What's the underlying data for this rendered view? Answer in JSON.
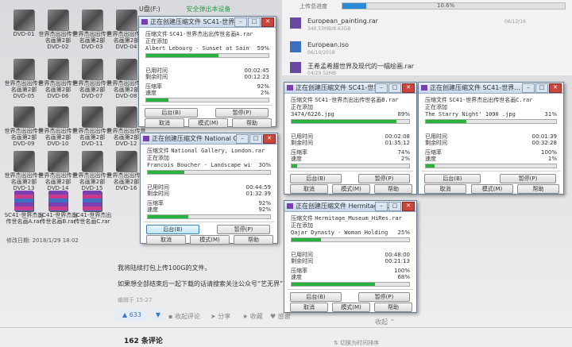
{
  "explorer": {
    "path_label": "U盘(F:)",
    "safe_eject": "安全弹出本设备",
    "icons": [
      {
        "label": "DVD-01",
        "type": "folder"
      },
      {
        "label": "世界杰出出传世名画第2部DVD-02",
        "type": "folder"
      },
      {
        "label": "世界杰出出传世名画第2部DVD-03",
        "type": "folder"
      },
      {
        "label": "世界杰出出传世名画第2部DVD-04",
        "type": "folder"
      },
      {
        "label": "世界杰出出传世名画第2部DVD-05",
        "type": "folder"
      },
      {
        "label": "世界杰出出传世名画第2部DVD-06",
        "type": "folder"
      },
      {
        "label": "世界杰出出传世名画第2部DVD-07",
        "type": "folder"
      },
      {
        "label": "世界杰出出传世名画第2部DVD-08",
        "type": "folder"
      },
      {
        "label": "世界杰出出传世名画第2部DVD-09",
        "type": "folder"
      },
      {
        "label": "世界杰出出传世名画第2部DVD-10",
        "type": "folder"
      },
      {
        "label": "世界杰出出传世名画第2部DVD-11",
        "type": "folder"
      },
      {
        "label": "世界杰出出传世名画第2部DVD-12",
        "type": "folder"
      },
      {
        "label": "世界杰出出传世名画第2部DVD-13",
        "type": "folder"
      },
      {
        "label": "世界杰出出传世名画第2部DVD-14",
        "type": "folder"
      },
      {
        "label": "世界杰出出传世名画第2部DVD-15",
        "type": "folder"
      },
      {
        "label": "世界杰出出传世名画第2部DVD-16",
        "type": "folder"
      },
      {
        "label": "SC41-世界杰出传世名画A.rar",
        "type": "rar"
      },
      {
        "label": "SC41-世界杰出传世名画B.rar",
        "type": "rar"
      },
      {
        "label": "SC41-世界杰出传世名画C.rar",
        "type": "rar"
      }
    ],
    "modified": "修改日期: 2018/1/29 18:02"
  },
  "upload": {
    "header": "上传总进度",
    "percent_text": "10.6%",
    "percent": 0.106,
    "files": [
      {
        "name": "European_painting.rar",
        "meta": "340.53MB/8.63GB",
        "date": "06/12/16"
      },
      {
        "name": "European.iso",
        "meta": "06/10/2018",
        "date": ""
      },
      {
        "name": "王希孟希腊世界及现代的一幅绘画.rar",
        "meta": "04/29 52MB",
        "date": ""
      }
    ]
  },
  "dialog_common": {
    "compress_label": "压缩文件",
    "adding": "正在添加",
    "elapsed": "已用时间",
    "remaining": "剩余时间",
    "ratio": "压缩率",
    "speed": "速度",
    "btn_background": "后台(B)",
    "btn_pause": "暂停(P)",
    "btn_cancel": "取消",
    "btn_mode": "模式(M)",
    "btn_help": "帮助"
  },
  "dialogs": [
    {
      "title": "正在创建压缩文件 SC41-世界...",
      "archive": "SC41-世界杰出出传世名画A.rar",
      "file": "Albert Lebourg - Sunset at Saint Mamm",
      "file_pct": "59%",
      "file_progress": 0.59,
      "elapsed": "00:02:45",
      "remaining": "00:12:23",
      "ratio": "92%",
      "speed": "2%",
      "total_progress": 0.18
    },
    {
      "title": "正在创建压缩文件 National Ga...",
      "archive": "National Gallery, London.rar",
      "file": "Francois Boucher - Landscape with a Wa",
      "file_pct": "30%",
      "file_progress": 0.3,
      "elapsed": "00:44:59",
      "remaining": "01:32:39",
      "ratio": "92%",
      "speed": "92%",
      "total_progress": 0.33
    },
    {
      "title": "正在创建压缩文件 SC41-世界...",
      "archive": "SC41-世界杰出出传世名画B.rar",
      "file": "3474/6226.jpg",
      "file_pct": "89%",
      "file_progress": 0.89,
      "elapsed": "00:02:08",
      "remaining": "01:35:12",
      "ratio": "74%",
      "speed": "2%",
      "total_progress": 0.05
    },
    {
      "title": "正在创建压缩文件 SC41-世界...",
      "archive": "SC41-世界杰出出传世名画C.rar",
      "file": "The Starry Night' 1090 .jpg",
      "file_pct": "31%",
      "file_progress": 0.31,
      "elapsed": "00:01:39",
      "remaining": "00:32:28",
      "ratio": "100%",
      "speed": "1%",
      "total_progress": 0.07
    },
    {
      "title": "正在创建压缩文件 Hermitage_...",
      "archive": "Hermitage_Museum_HiRes.rar",
      "file": "Qajar Dynasty - Woman Holding A Rose -",
      "file_pct": "25%",
      "file_progress": 0.25,
      "elapsed": "00:48:00",
      "remaining": "00:21:13",
      "ratio": "100%",
      "speed": "68%",
      "total_progress": 0.71
    }
  ],
  "post": {
    "line1": "我将陆续打包上传100G的文件。",
    "line2": "如果想全部结束后一起下载的话请搜索关注公众号“艺无界”",
    "edit_time": "编辑于 15:27",
    "vote_count": "633",
    "collect": "收起评论",
    "share": "分享",
    "favorite": "收藏",
    "thanks": "感谢",
    "collapse": "收起",
    "comments": "162 条评论",
    "switch_order": "切换为时间排序"
  }
}
